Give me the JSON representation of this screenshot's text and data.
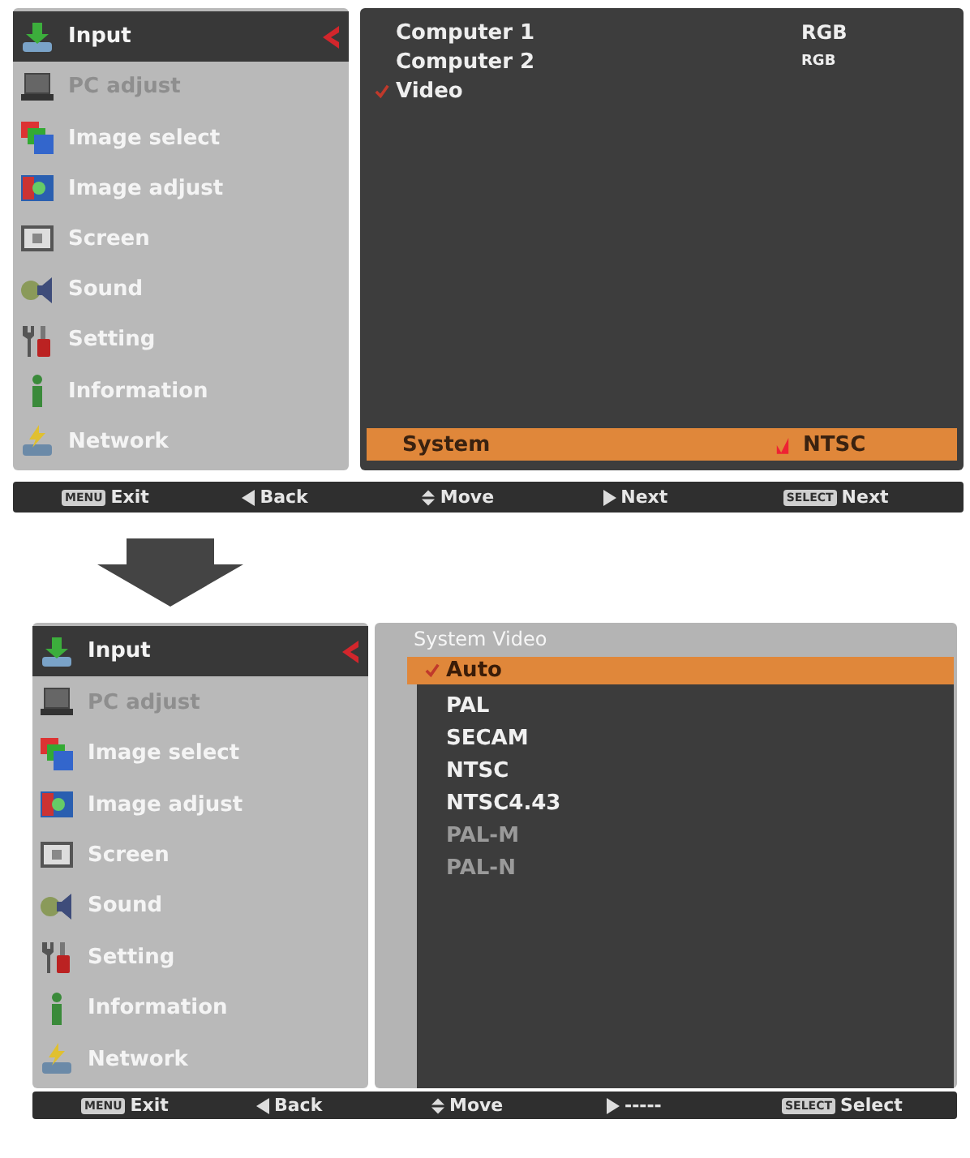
{
  "screens": [
    {
      "sidebar": [
        {
          "label": "Input",
          "selected": true,
          "disabled": false
        },
        {
          "label": "PC adjust",
          "selected": false,
          "disabled": true
        },
        {
          "label": "Image select",
          "selected": false,
          "disabled": false
        },
        {
          "label": "Image adjust",
          "selected": false,
          "disabled": false
        },
        {
          "label": "Screen",
          "selected": false,
          "disabled": false
        },
        {
          "label": "Sound",
          "selected": false,
          "disabled": false
        },
        {
          "label": "Setting",
          "selected": false,
          "disabled": false
        },
        {
          "label": "Information",
          "selected": false,
          "disabled": false
        },
        {
          "label": "Network",
          "selected": false,
          "disabled": false
        }
      ],
      "panel": {
        "kind": "inputs",
        "rows": [
          {
            "label": "Computer 1",
            "value": "RGB",
            "checked": false
          },
          {
            "label": "Computer 2",
            "value": "RGB",
            "checked": false
          },
          {
            "label": "Video",
            "checked": true
          }
        ],
        "system": {
          "label": "System",
          "value": "NTSC"
        }
      },
      "footer": [
        {
          "kind": "key",
          "key": "MENU",
          "label": "Exit"
        },
        {
          "kind": "left",
          "label": "Back"
        },
        {
          "kind": "updown",
          "label": "Move"
        },
        {
          "kind": "right",
          "label": "Next"
        },
        {
          "kind": "key",
          "key": "SELECT",
          "label": "Next"
        }
      ]
    },
    {
      "sidebar": [
        {
          "label": "Input",
          "selected": true,
          "disabled": false
        },
        {
          "label": "PC adjust",
          "selected": false,
          "disabled": true
        },
        {
          "label": "Image select",
          "selected": false,
          "disabled": false
        },
        {
          "label": "Image adjust",
          "selected": false,
          "disabled": false
        },
        {
          "label": "Screen",
          "selected": false,
          "disabled": false
        },
        {
          "label": "Sound",
          "selected": false,
          "disabled": false
        },
        {
          "label": "Setting",
          "selected": false,
          "disabled": false
        },
        {
          "label": "Information",
          "selected": false,
          "disabled": false
        },
        {
          "label": "Network",
          "selected": false,
          "disabled": false
        }
      ],
      "panel": {
        "kind": "submenu",
        "title": "System Video",
        "options": [
          {
            "label": "Auto",
            "checked": true,
            "selected": true,
            "disabled": false
          },
          {
            "label": "PAL",
            "checked": false,
            "selected": false,
            "disabled": false
          },
          {
            "label": "SECAM",
            "checked": false,
            "selected": false,
            "disabled": false
          },
          {
            "label": "NTSC",
            "checked": false,
            "selected": false,
            "disabled": false
          },
          {
            "label": "NTSC4.43",
            "checked": false,
            "selected": false,
            "disabled": false
          },
          {
            "label": "PAL-M",
            "checked": false,
            "selected": false,
            "disabled": true
          },
          {
            "label": "PAL-N",
            "checked": false,
            "selected": false,
            "disabled": true
          }
        ]
      },
      "footer": [
        {
          "kind": "key",
          "key": "MENU",
          "label": "Exit"
        },
        {
          "kind": "left",
          "label": "Back"
        },
        {
          "kind": "updown",
          "label": "Move"
        },
        {
          "kind": "right",
          "label": "-----"
        },
        {
          "kind": "key",
          "key": "SELECT",
          "label": "Select"
        }
      ]
    }
  ]
}
